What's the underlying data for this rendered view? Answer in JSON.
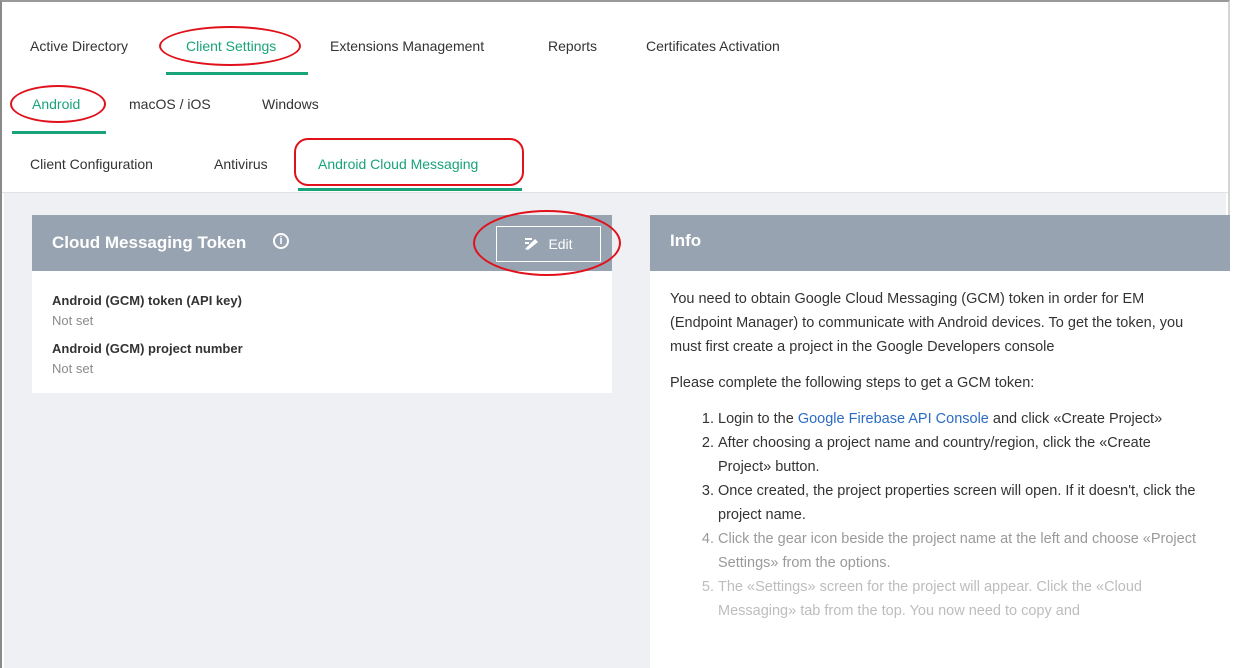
{
  "tabs_main": {
    "items": [
      {
        "label": "Active Directory"
      },
      {
        "label": "Client Settings"
      },
      {
        "label": "Extensions Management"
      },
      {
        "label": "Reports"
      },
      {
        "label": "Certificates Activation"
      }
    ],
    "active_index": 1
  },
  "tabs_os": {
    "items": [
      {
        "label": "Android"
      },
      {
        "label": "macOS / iOS"
      },
      {
        "label": "Windows"
      }
    ],
    "active_index": 0
  },
  "tabs_android": {
    "items": [
      {
        "label": "Client Configuration"
      },
      {
        "label": "Antivirus"
      },
      {
        "label": "Android Cloud Messaging"
      }
    ],
    "active_index": 2
  },
  "token_card": {
    "title": "Cloud Messaging Token",
    "edit_label": "Edit",
    "fields": [
      {
        "label": "Android (GCM) token (API key)",
        "value": "Not set"
      },
      {
        "label": "Android (GCM) project number",
        "value": "Not set"
      }
    ]
  },
  "info_card": {
    "title": "Info",
    "intro": "You need to obtain Google Cloud Messaging (GCM) token in order for EM (Endpoint Manager) to communicate with Android devices. To get the token, you must first create a project in the Google Developers console",
    "steps_intro": "Please complete the following steps to get a GCM token:",
    "step1_pre": "Login to the ",
    "step1_link": "Google Firebase API Console",
    "step1_post": " and click «Create Project»",
    "step2": "After choosing a project name and country/region, click the «Create Project» button.",
    "step3": "Once created, the project properties screen will open. If it doesn't, click the project name.",
    "step4": "Click the gear icon beside the project name at the left and choose «Project Settings» from the options.",
    "step5": "The «Settings» screen for the project will appear. Click the «Cloud Messaging» tab from the top. You now need to copy and"
  },
  "colors": {
    "accent": "#18a37a",
    "annotation": "#e0111b",
    "card_header": "#97a3b0",
    "link": "#2b6cc4"
  }
}
